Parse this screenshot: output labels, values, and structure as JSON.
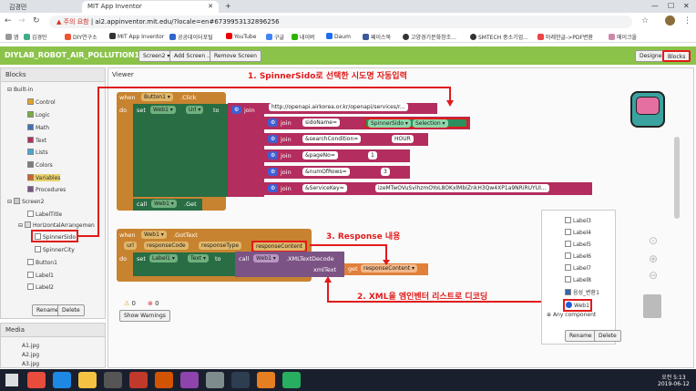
{
  "browser": {
    "tabs": [
      "김경민",
      "MIT App Inventor"
    ],
    "new_tab": "+",
    "warning": "주의 요함",
    "url": "ai2.appinventor.mit.edu/?locale=en#6739953132896256",
    "bookmarks": [
      "앱",
      "김경민",
      "DIY연구소",
      "MIT App Inventor",
      "공공데이터포털",
      "YouTube",
      "구글",
      "네이버",
      "Daum",
      "페이스북",
      "고양경기문화창조...",
      "SMTECH 중소기업...",
      "마레한글->PDF변환",
      "메이크올"
    ]
  },
  "appbar": {
    "project": "DIYLAB_ROBOT_AIR_POLLUTION1",
    "screen": "Screen2 ▾",
    "add_screen": "Add Screen ...",
    "remove_screen": "Remove Screen",
    "designer": "Designer",
    "blocks": "Blocks"
  },
  "left": {
    "title": "Blocks",
    "items": [
      "Built-in",
      "Control",
      "Logic",
      "Math",
      "Text",
      "Lists",
      "Colors",
      "Variables",
      "Procedures",
      "Screen2",
      "LabelTitle",
      "HorizontalArrangemen",
      "SpinnerSido",
      "SpinnerCity",
      "Button1",
      "Label1",
      "Label2"
    ],
    "rename": "Rename",
    "delete": "Delete",
    "media_title": "Media",
    "media": [
      "A1.jpg",
      "A2.jpg",
      "A3.jpg"
    ]
  },
  "viewer": {
    "title": "Viewer",
    "warn_count": "0",
    "err_count": "0",
    "show_warnings": "Show Warnings"
  },
  "blocks": {
    "when1": "when",
    "btn": "Button1 ▾",
    "click": ".Click",
    "do": "do",
    "set": "set",
    "web1": "Web1 ▾",
    "url": "Url ▾",
    "to": "to",
    "join": "join",
    "url_str": "http://openapi.airkorea.or.kr/openapi/services/r...",
    "sido": "sidoName=",
    "spinner": "SpinnerSido ▾",
    "selection": "Selection ▾",
    "search": "&searchCondition=",
    "hour": "HOUR",
    "page": "&pageNo=",
    "one": "1",
    "rows": "&numOfRows=",
    "three": "3",
    "key": "&ServiceKey=",
    "keyval": "izeMTwOVuSvihzmOYoL8OKxlMbIZnkH3Qw4XP1a9NRiRUYUI...",
    "call": "call",
    "get": ".Get",
    "when2": "when",
    "web1b": "Web1 ▾",
    ".gottext": ".GotText",
    "url_p": "url",
    "code_p": "responseCode",
    "type_p": "responseType",
    "content_p": "responseContent",
    "label1": "Label1 ▾",
    "text": "Text ▾",
    "xml": ".XMLTextDecode",
    "xmltext": "xmlText",
    "get2": "get",
    "rc": "responseContent ▾"
  },
  "annotations": {
    "a1": "1. SpinnerSido로 선택한 시도명 자동입력",
    "a2": "2. XML을 엠인벤터 리스트로 디코딩",
    "a3": "3. Response 내용"
  },
  "flyout": {
    "items": [
      "Label3",
      "Label4",
      "Label5",
      "Label6",
      "Label7",
      "Label8",
      "음성_변환1",
      "Web1"
    ],
    "any": "Any component",
    "rename": "Rename",
    "delete": "Delete"
  },
  "clock": {
    "time": "오전 5:13",
    "date": "2019-06-12"
  }
}
